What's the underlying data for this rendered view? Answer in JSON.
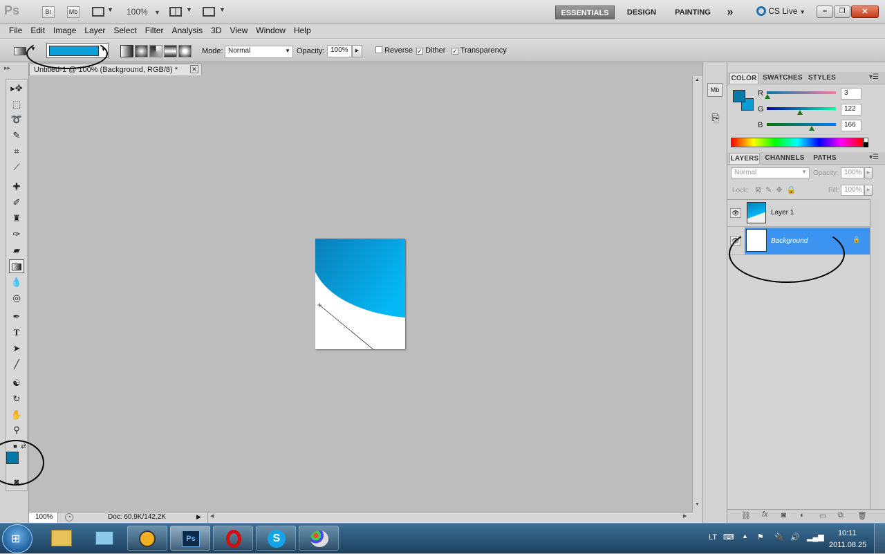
{
  "app": {
    "logo": "Ps",
    "bridge_label": "Br",
    "minibridge_label": "Mb",
    "zoom": "100%",
    "workspaces": [
      "ESSENTIALS",
      "DESIGN",
      "PAINTING"
    ],
    "more_label": "»",
    "cslive": "CS Live"
  },
  "menu": [
    "File",
    "Edit",
    "Image",
    "Layer",
    "Select",
    "Filter",
    "Analysis",
    "3D",
    "View",
    "Window",
    "Help"
  ],
  "options": {
    "mode_label": "Mode:",
    "mode_value": "Normal",
    "opacity_label": "Opacity:",
    "opacity_value": "100%",
    "reverse_label": "Reverse",
    "dither_label": "Dither",
    "transparency_label": "Transparency",
    "reverse_checked": false,
    "dither_checked": true,
    "transparency_checked": true,
    "gradient_color": "#0aa2d8"
  },
  "document": {
    "tab_title": "Untitled-1 @ 100% (Background, RGB/8) *",
    "zoom": "100%",
    "doc_info": "Doc: 60,9K/142,2K"
  },
  "color_panel": {
    "tabs": [
      "COLOR",
      "SWATCHES",
      "STYLES"
    ],
    "r_label": "R",
    "g_label": "G",
    "b_label": "B",
    "r_value": "3",
    "g_value": "122",
    "b_value": "166",
    "r": 3,
    "g": 122,
    "b": 166,
    "foreground": "#037aa6",
    "background": "#0a9ad6"
  },
  "layers_panel": {
    "tabs": [
      "LAYERS",
      "CHANNELS",
      "PATHS"
    ],
    "blend_mode": "Normal",
    "opacity_label": "Opacity:",
    "opacity_value": "100%",
    "lock_label": "Lock:",
    "fill_label": "Fill:",
    "fill_value": "100%",
    "layers": [
      {
        "name": "Layer 1",
        "selected": false
      },
      {
        "name": "Background",
        "selected": true
      }
    ]
  },
  "tray": {
    "lang": "LT",
    "time": "10:11",
    "date": "2011.08.25"
  }
}
